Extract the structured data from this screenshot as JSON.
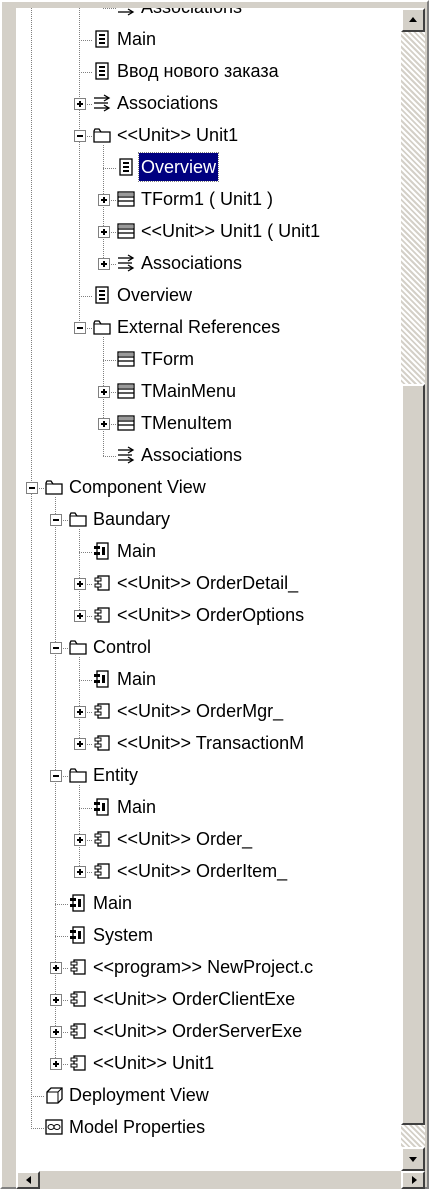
{
  "tree": {
    "items": [
      {
        "label": "Associations",
        "level": 4,
        "icon": "association-icon",
        "expander": "none"
      },
      {
        "label": "Main",
        "level": 3,
        "icon": "class-diagram-icon",
        "expander": "none"
      },
      {
        "label": "Ввод нового заказа",
        "level": 3,
        "icon": "class-diagram-icon",
        "expander": "none"
      },
      {
        "label": "Associations",
        "level": 3,
        "icon": "association-icon",
        "expander": "plus"
      },
      {
        "label": "<<Unit>> Unit1",
        "level": 3,
        "icon": "folder-icon",
        "expander": "minus"
      },
      {
        "label": "Overview",
        "level": 4,
        "icon": "class-diagram-icon",
        "expander": "none",
        "selected": true
      },
      {
        "label": "TForm1 ( Unit1 )",
        "level": 4,
        "icon": "class-icon",
        "expander": "plus"
      },
      {
        "label": "<<Unit>> Unit1 ( Unit1",
        "level": 4,
        "icon": "class-icon",
        "expander": "plus"
      },
      {
        "label": "Associations",
        "level": 4,
        "icon": "association-icon",
        "expander": "plus"
      },
      {
        "label": "Overview",
        "level": 3,
        "icon": "class-diagram-icon",
        "expander": "none"
      },
      {
        "label": "External References",
        "level": 3,
        "icon": "folder-icon",
        "expander": "minus"
      },
      {
        "label": "TForm",
        "level": 4,
        "icon": "class-icon",
        "expander": "none"
      },
      {
        "label": "TMainMenu",
        "level": 4,
        "icon": "class-icon",
        "expander": "plus"
      },
      {
        "label": "TMenuItem",
        "level": 4,
        "icon": "class-icon",
        "expander": "plus"
      },
      {
        "label": "Associations",
        "level": 4,
        "icon": "association-icon",
        "expander": "none"
      },
      {
        "label": "Component View",
        "level": 1,
        "icon": "folder-icon",
        "expander": "minus"
      },
      {
        "label": "Baundary",
        "level": 2,
        "icon": "folder-icon",
        "expander": "minus"
      },
      {
        "label": "Main",
        "level": 3,
        "icon": "component-diagram-icon",
        "expander": "none"
      },
      {
        "label": "<<Unit>> OrderDetail_",
        "level": 3,
        "icon": "component-icon",
        "expander": "plus"
      },
      {
        "label": "<<Unit>> OrderOptions",
        "level": 3,
        "icon": "component-icon",
        "expander": "plus"
      },
      {
        "label": "Control",
        "level": 2,
        "icon": "folder-icon",
        "expander": "minus"
      },
      {
        "label": "Main",
        "level": 3,
        "icon": "component-diagram-icon",
        "expander": "none"
      },
      {
        "label": "<<Unit>> OrderMgr_",
        "level": 3,
        "icon": "component-icon",
        "expander": "plus"
      },
      {
        "label": "<<Unit>> TransactionM",
        "level": 3,
        "icon": "component-icon",
        "expander": "plus"
      },
      {
        "label": "Entity",
        "level": 2,
        "icon": "folder-icon",
        "expander": "minus"
      },
      {
        "label": "Main",
        "level": 3,
        "icon": "component-diagram-icon",
        "expander": "none"
      },
      {
        "label": "<<Unit>> Order_",
        "level": 3,
        "icon": "component-icon",
        "expander": "plus"
      },
      {
        "label": "<<Unit>> OrderItem_",
        "level": 3,
        "icon": "component-icon",
        "expander": "plus"
      },
      {
        "label": "Main",
        "level": 2,
        "icon": "component-diagram-icon",
        "expander": "none"
      },
      {
        "label": "System",
        "level": 2,
        "icon": "component-diagram-icon",
        "expander": "none"
      },
      {
        "label": "<<program>> NewProject.c",
        "level": 2,
        "icon": "component-icon",
        "expander": "plus"
      },
      {
        "label": "<<Unit>> OrderClientExe",
        "level": 2,
        "icon": "component-icon",
        "expander": "plus"
      },
      {
        "label": "<<Unit>> OrderServerExe",
        "level": 2,
        "icon": "component-icon",
        "expander": "plus"
      },
      {
        "label": "<<Unit>> Unit1",
        "level": 2,
        "icon": "component-icon",
        "expander": "plus"
      },
      {
        "label": "Deployment View",
        "level": 1,
        "icon": "deployment-diagram-icon",
        "expander": "none"
      },
      {
        "label": "Model Properties",
        "level": 1,
        "icon": "model-properties-icon",
        "expander": "none"
      }
    ]
  },
  "scrollbar": {
    "vertical_icon_up": "scroll-up-arrow-icon",
    "vertical_icon_down": "scroll-down-arrow-icon",
    "horizontal_icon_left": "scroll-left-arrow-icon",
    "horizontal_icon_right": "scroll-right-arrow-icon"
  },
  "colors": {
    "selection": "#000080",
    "window": "#d4d0c8"
  }
}
